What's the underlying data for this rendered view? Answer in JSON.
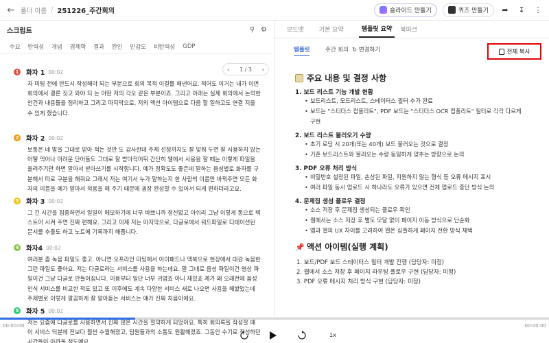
{
  "header": {
    "folder": "폴더 이름",
    "separator": "/",
    "file": "251226_주간회의",
    "slides_button": "슬라이드 만들기",
    "quiz_button": "퀴즈 만들기"
  },
  "left": {
    "title": "스크립트",
    "tags": [
      "수요",
      "탄력성",
      "개념",
      "경제학",
      "결과",
      "완인",
      "민감도",
      "비탄력성",
      "GDP"
    ],
    "pager": {
      "current": "1",
      "total": "3"
    },
    "speakers": [
      {
        "name": "화자 1",
        "time": "00:02",
        "color": "#e74c3c",
        "num": "1",
        "text": "자 미팅 전에 반드시 작성해야 되는 부분으로 회의 목적 이걸를 해낸어요. 적어도 이거는 내가 이번 회의에서 결론 짓고 와야 되 는 어떤 저의 각오 같은 부분이죠. 그리고 아래는 실제 회의에서 논의한 안건과 내용들을 정리하고 그리고 마지막으로, 저의 액션 아이템으로 다음 할 일하고도 연결 지을 수 있게 했습니다."
      },
      {
        "name": "화자 2",
        "time": "00:02",
        "color": "#f39c12",
        "num": "2",
        "text": "보통은 네 말을 그대로 받아 적는 것만 도 감사한데 주제 선정까지도 잘 맞춰 두면 잘 사용하지 않는 어떻 먹어나 어려운 단어들도 그대로 잘 받아적어뒤 간단히 웹에서 사용을 할 때는 이렇게 파일을 올려주기만 하면 알아서 받아쓰기를 시작합니다. 예가 정확도도 좋은데 말하는 음성별로 화자를 구분해서 따로 구분을 해줘요 그래서 저는 여기서 누가 말하는지 한 사람씩 이름만 바꿔주면 모든 화자의 이름을 예가 알아서 적용을 해 주기 때문에 굉장 완성할 수 있어서 되게 편하더라고요."
      },
      {
        "name": "화자 3",
        "time": "00:02",
        "color": "#f1c40f",
        "num": "3",
        "text": "그 긴 시간을 집중하면서 일일이 메모하기에 너무 바쁘니까 정신없고 아쉬리 그냥 이렇게 통으로 텍스트어 시켜 주면 진짜 편해요. 그리고 이제 저는 마지막으로, 다글로에서 워드파일로 디테이션된 문서를 추출도 하고 노트에 기록까지 해줍니다."
      },
      {
        "name": "화자4",
        "time": "00:02",
        "color": "#8bc34a",
        "num": "4",
        "text": "여러분 좀 녹음 파일도 좋고. 아니면 오프라인 미팅에서 아이패드나 맥북으로 현장에서 대강 녹음한 그런 파일도 좋아요. 저는 다글로라는 서비스를 사용을 하는데요. 말 그대로 음성 파일이건 영상 파일이건 그냥 다글로 만들어집니다. 이용부터 일단 너무 귀엽죠 아니 재밌죠 제가 왜 오래전에 음성 인식 서비스를 비교한 적도 있고 또 이후에도 계속 다양한 서비스 새로 나오면 사용을 해봤었는데 주제별로 이렇게 깔끔하게 잘 알아듣는 서비스는 얘가 진짜 처음이에요."
      },
      {
        "name": "화자 5",
        "time": "00:02",
        "color": "#2ecc71",
        "num": "5",
        "text": "저는 요즘에 다글로를 사용하면서 진짜 많은 시간을 절약하게 되었어요. 특히 회의록을 작성할 때 이 서비스 덕분에 전보다 훨씬 수월해졌고, 팀원들과의 소통도 원활해졌죠. 그동안 수기로 작성하던 시간들이 아까울 정도예요."
      }
    ]
  },
  "right": {
    "tabs": [
      "보드맷",
      "기본 요약",
      "템플릿 요약",
      "북마크"
    ],
    "active_tab": 2,
    "subtab_template": "템플릿",
    "subtab_weekly": "주간 회의",
    "change_label": "변경하기",
    "copy_all": "전체 복사",
    "section1_title": "주요 내용 및 결정 사항",
    "items": [
      {
        "heading": "1. 보드 리스트 기능 개발 현황",
        "bullets": [
          "보드리스트, 모드리스트, 스테이터스 필터 추가 완료",
          "보드는 \"스티더스 컴플리트\", PDF 보드는 \"스티더스 OCR 컴플리트\" 필터로 각각 다르게",
          "구현"
        ]
      },
      {
        "heading": "2. 보드 리스트 불러오기 수량",
        "bullets": [
          "초기 로딩 시 20개(또는 40개) 보드 불러오는 것으로 결정",
          "기존 보드리스트와 불러오는 수량 동일하게 맞추는 방향으로 논의"
        ]
      },
      {
        "heading": "3. PDF 오류 처리 방식",
        "bullets": [
          "비밀번호 설정된 파일, 손상된 파일, 지원하지 않는 형식 등 오류 메시지 표시",
          "여러 파일 동시 업로드 시 하나라도 오류가 있으면 전체 업로드 중단 방식 논의"
        ]
      },
      {
        "heading": "4. 문제집 생성 플로우 결정",
        "bullets": [
          "소스 저장 후 문제집 생성되는 플로우 확인",
          "웹에서는 소스 저장 후 별도 모달 없이 페이지 이동 방식으로 단순화",
          "앱과 웹의 UX 차이를 고려하여 웹은 심플하게 페이지 전환 방식 채택"
        ]
      }
    ],
    "section2_title": "액션 아이템(실행 계획)",
    "actions": [
      "1. 보드/PDF 보드 스테이터스 필터 개발 진행 (담당자: 미정)",
      "2. 웹에서 소스 저장 후 페이지 라우팅 플로우 구현 (담당자: 미정)",
      "3. PDF 오류 메시지 처리 방식 구현 (담당자: 미정)"
    ]
  },
  "player": {
    "start": "00:00:00",
    "end": "00:00:00",
    "speed": "1x",
    "progress": 0.246
  }
}
